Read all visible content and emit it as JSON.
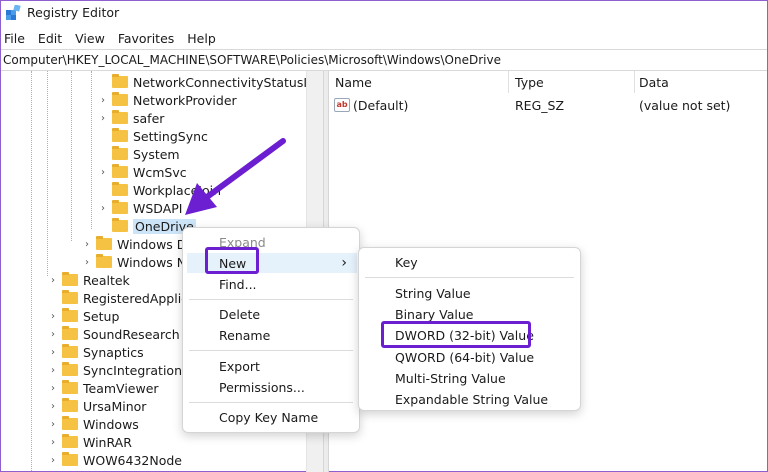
{
  "window": {
    "title": "Registry Editor"
  },
  "menubar": [
    "File",
    "Edit",
    "View",
    "Favorites",
    "Help"
  ],
  "address": "Computer\\HKEY_LOCAL_MACHINE\\SOFTWARE\\Policies\\Microsoft\\Windows\\OneDrive",
  "tree": [
    {
      "label": "NetworkConnectivityStatusIndica",
      "chevron": ""
    },
    {
      "label": "NetworkProvider",
      "chevron": "›"
    },
    {
      "label": "safer",
      "chevron": "›"
    },
    {
      "label": "SettingSync",
      "chevron": ""
    },
    {
      "label": "System",
      "chevron": ""
    },
    {
      "label": "WcmSvc",
      "chevron": "›"
    },
    {
      "label": "WorkplaceJoin",
      "chevron": ""
    },
    {
      "label": "WSDAPI",
      "chevron": "›"
    },
    {
      "label": "OneDrive",
      "chevron": "",
      "selected": true
    },
    {
      "label": "Windows De",
      "chevron": "›"
    },
    {
      "label": "Windows NT",
      "chevron": "›"
    },
    {
      "label": "Realtek",
      "chevron": "›"
    },
    {
      "label": "RegisteredApplica",
      "chevron": ""
    },
    {
      "label": "Setup",
      "chevron": "›"
    },
    {
      "label": "SoundResearch",
      "chevron": "›"
    },
    {
      "label": "Synaptics",
      "chevron": "›"
    },
    {
      "label": "SyncIntegrationCli",
      "chevron": "›"
    },
    {
      "label": "TeamViewer",
      "chevron": "›"
    },
    {
      "label": "UrsaMinor",
      "chevron": "›"
    },
    {
      "label": "Windows",
      "chevron": "›"
    },
    {
      "label": "WinRAR",
      "chevron": "›"
    },
    {
      "label": "WOW6432Node",
      "chevron": "›"
    }
  ],
  "columns": {
    "name": "Name",
    "type": "Type",
    "data": "Data"
  },
  "values": [
    {
      "icon": "ab",
      "name": "(Default)",
      "type": "REG_SZ",
      "data": "(value not set)"
    }
  ],
  "context_menu": {
    "expand": "Expand",
    "new": "New",
    "find": "Find...",
    "delete": "Delete",
    "rename": "Rename",
    "export": "Export",
    "permissions": "Permissions...",
    "copy_key_name": "Copy Key Name",
    "submenu_arrow": "›"
  },
  "new_submenu": {
    "key": "Key",
    "string": "String Value",
    "binary": "Binary Value",
    "dword": "DWORD (32-bit) Value",
    "qword": "QWORD (64-bit) Value",
    "multi": "Multi-String Value",
    "expandable": "Expandable String Value"
  },
  "colors": {
    "annotation": "#6b1fd1",
    "folder": "#f5c244",
    "selection": "#cce4f7"
  }
}
